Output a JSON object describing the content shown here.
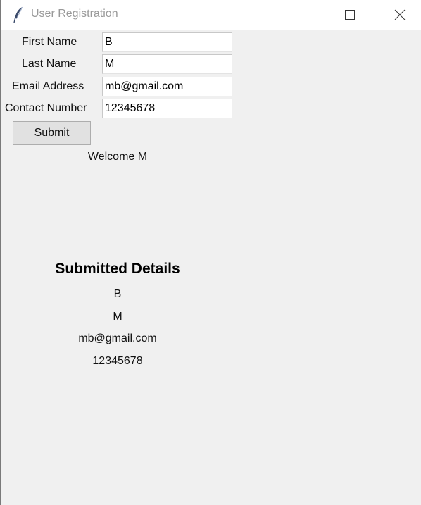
{
  "window": {
    "title": "User Registration",
    "app_icon": "feather-icon",
    "controls": {
      "minimize_icon": "minimize-icon",
      "maximize_icon": "maximize-icon",
      "close_icon": "close-icon"
    }
  },
  "form": {
    "fields": [
      {
        "label": "First Name",
        "value": "B"
      },
      {
        "label": "Last Name",
        "value": "M"
      },
      {
        "label": "Email Address",
        "value": "mb@gmail.com"
      },
      {
        "label": "Contact Number",
        "value": "12345678"
      }
    ],
    "submit_label": "Submit"
  },
  "welcome_message": "Welcome M",
  "details": {
    "heading": "Submitted Details",
    "first_name": "B",
    "last_name": "M",
    "email": "mb@gmail.com",
    "contact": "12345678"
  },
  "colors": {
    "window_bg": "#f0f0f0",
    "titlebar_bg": "#ffffff",
    "title_text": "#999999"
  }
}
